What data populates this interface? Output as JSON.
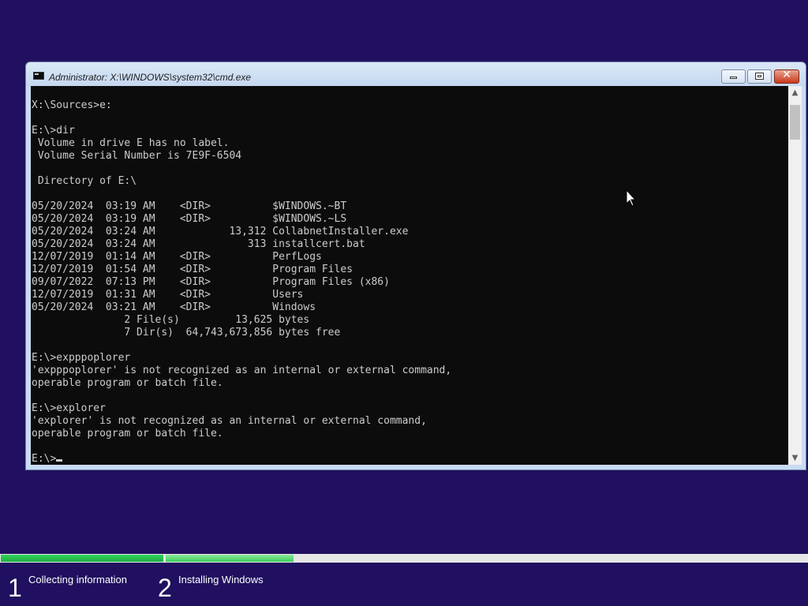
{
  "window": {
    "title": "Administrator: X:\\WINDOWS\\system32\\cmd.exe",
    "console_lines": [
      "X:\\Sources>e:",
      "",
      "E:\\>dir",
      " Volume in drive E has no label.",
      " Volume Serial Number is 7E9F-6504",
      "",
      " Directory of E:\\",
      "",
      "05/20/2024  03:19 AM    <DIR>          $WINDOWS.~BT",
      "05/20/2024  03:19 AM    <DIR>          $WINDOWS.~LS",
      "05/20/2024  03:24 AM            13,312 CollabnetInstaller.exe",
      "05/20/2024  03:24 AM               313 installcert.bat",
      "12/07/2019  01:14 AM    <DIR>          PerfLogs",
      "12/07/2019  01:54 AM    <DIR>          Program Files",
      "09/07/2022  07:13 PM    <DIR>          Program Files (x86)",
      "12/07/2019  01:31 AM    <DIR>          Users",
      "05/20/2024  03:21 AM    <DIR>          Windows",
      "               2 File(s)         13,625 bytes",
      "               7 Dir(s)  64,743,673,856 bytes free",
      "",
      "E:\\>expppoplorer",
      "'expppoplorer' is not recognized as an internal or external command,",
      "operable program or batch file.",
      "",
      "E:\\>explorer",
      "'explorer' is not recognized as an internal or external command,",
      "operable program or batch file.",
      ""
    ],
    "prompt": "E:\\>"
  },
  "icons": {
    "app": "console-icon",
    "minimize": "minimize-icon",
    "maximize": "maximize-icon",
    "close": "close-icon",
    "close_glyph": "✕",
    "scroll_up": "▲",
    "scroll_down": "▼",
    "pointer": "mouse-pointer-icon"
  },
  "setup": {
    "steps": [
      {
        "number": "1",
        "label": "Collecting information",
        "progress": 1.0
      },
      {
        "number": "2",
        "label": "Installing Windows",
        "progress": 0.2
      }
    ],
    "colors": {
      "progress_fill": "#2fd35a",
      "background": "#21105f"
    }
  }
}
